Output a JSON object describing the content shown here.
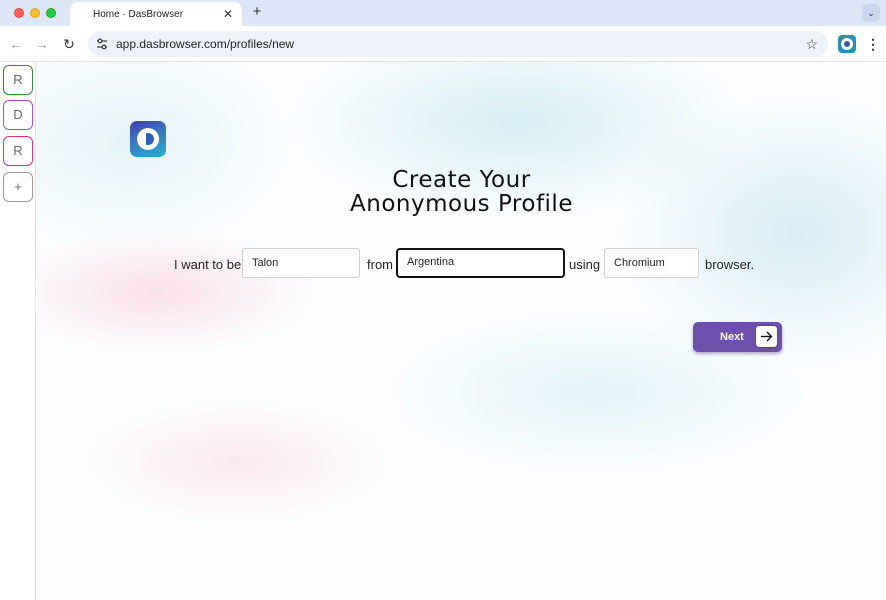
{
  "browser": {
    "tab_title": "Home · DasBrowser",
    "tab_close": "✕",
    "new_tab": "+",
    "tab_menu": "⌄",
    "url": "app.dasbrowser.com/profiles/new",
    "nav_back": "←",
    "nav_forward": "→",
    "nav_reload": "↻",
    "bookmark": "☆",
    "menu": "⋮"
  },
  "sidebar": {
    "profiles": [
      {
        "label": "R",
        "color": "#2e8b3f"
      },
      {
        "label": "D",
        "color": "#a04fd6"
      },
      {
        "label": "R",
        "color": "#d63384"
      },
      {
        "label": "+",
        "color": "#9a9a9a"
      }
    ]
  },
  "page": {
    "heading_line1": "Create Your",
    "heading_line2": "Anonymous Profile",
    "sentence": {
      "prefix": "I want to be",
      "name_value": "Talon",
      "from_label": "from",
      "country_value": "Argentina",
      "using_label": "using",
      "browser_value": "Chromium",
      "suffix": "browser."
    },
    "next_button": "Next"
  },
  "colors": {
    "accent": "#6f4fac",
    "tab_strip": "#dde7f8",
    "omnibox": "#edf1f9"
  },
  "icons": {
    "site_info": "site-settings-icon",
    "next_arrow": "arrow-right-icon",
    "logo": "dasbrowser-logo-icon",
    "extension": "dasbrowser-extension-icon"
  }
}
